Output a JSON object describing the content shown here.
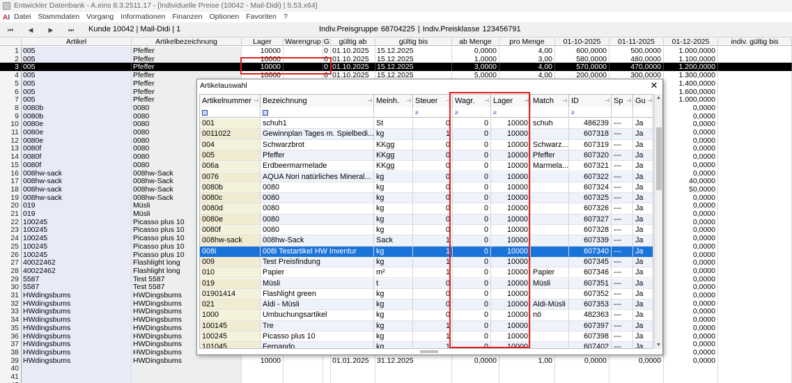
{
  "window": {
    "title": "Entwickler Datenbank - A.eins 8.3.2511.17 - [Individuelle Preise (10042 - Mail-Didi) | 5.53.x64]"
  },
  "menu": {
    "logo": "A",
    "logo2": "I",
    "items": [
      "Datei",
      "Stammdaten",
      "Vorgang",
      "Informationen",
      "Finanzen",
      "Optionen",
      "Favoriten",
      "?"
    ]
  },
  "nav": {
    "first": "⏮",
    "prev": "◀",
    "next": "▶",
    "last": "⏭",
    "kunde": "Kunde 10042 | Mail-Didi | 1",
    "preisgruppe": "Indiv.Preisgruppe 68704225 | Indiv.Preisklasse 123456791"
  },
  "grid": {
    "headers": [
      "Artikel",
      "Artikelbezeichnung",
      "Lager",
      "Warengrup",
      "G",
      "gültig ab",
      "gültig bis",
      "ab Menge",
      "pro Menge",
      "01-10-2025",
      "01-11-2025",
      "01-12-2025",
      "indiv. gültig bis"
    ],
    "rows": [
      [
        "1",
        "005",
        "Pfeffer",
        "10000",
        "0",
        "01.10.2025",
        "15.12.2025",
        "0,0000",
        "4,00",
        "600,0000",
        "500,0000",
        "1.000,0000",
        ""
      ],
      [
        "2",
        "005",
        "Pfeffer",
        "10000",
        "0",
        "01.10.2025",
        "15.12.2025",
        "1,0000",
        "3,00",
        "580,0000",
        "480,0000",
        "1.100,0000",
        ""
      ],
      [
        "3",
        "005",
        "Pfeffer",
        "10000",
        "0",
        "01.10.2025",
        "15.12.2025",
        "3,0000",
        "4,00",
        "570,0000",
        "470,0000",
        "1.200,0000",
        ""
      ],
      [
        "4",
        "005",
        "Pfeffer",
        "10000",
        "0",
        "01.10.2025",
        "15.12.2025",
        "5,0000",
        "4,00",
        "200,0000",
        "300,0000",
        "1.300,0000",
        ""
      ],
      [
        "5",
        "005",
        "Pfeffer",
        "",
        "",
        "",
        "",
        "",
        "",
        "",
        "",
        "1.400,0000",
        ""
      ],
      [
        "6",
        "005",
        "Pfeffer",
        "",
        "",
        "",
        "",
        "",
        "",
        "",
        "",
        "1.600,0000",
        ""
      ],
      [
        "7",
        "005",
        "Pfeffer",
        "",
        "",
        "",
        "",
        "",
        "",
        "",
        "",
        "1.000,0000",
        ""
      ],
      [
        "8",
        "0080b",
        "0080",
        "",
        "",
        "",
        "",
        "",
        "",
        "",
        "",
        "0,0000",
        ""
      ],
      [
        "9",
        "0080b",
        "0080",
        "",
        "",
        "",
        "",
        "",
        "",
        "",
        "",
        "0,0000",
        ""
      ],
      [
        "10",
        "0080e",
        "0080",
        "",
        "",
        "",
        "",
        "",
        "",
        "",
        "",
        "0,0000",
        ""
      ],
      [
        "11",
        "0080e",
        "0080",
        "",
        "",
        "",
        "",
        "",
        "",
        "",
        "",
        "0,0000",
        ""
      ],
      [
        "12",
        "0080e",
        "0080",
        "",
        "",
        "",
        "",
        "",
        "",
        "",
        "",
        "0,0000",
        ""
      ],
      [
        "13",
        "0080f",
        "0080",
        "",
        "",
        "",
        "",
        "",
        "",
        "",
        "",
        "0,0000",
        ""
      ],
      [
        "14",
        "0080f",
        "0080",
        "",
        "",
        "",
        "",
        "",
        "",
        "",
        "",
        "0,0000",
        ""
      ],
      [
        "15",
        "0080f",
        "0080",
        "",
        "",
        "",
        "",
        "",
        "",
        "",
        "",
        "0,0000",
        ""
      ],
      [
        "16",
        "008hw-sack",
        "008hw-Sack",
        "",
        "",
        "",
        "",
        "",
        "",
        "",
        "",
        "0,0000",
        ""
      ],
      [
        "17",
        "008hw-sack",
        "008hw-Sack",
        "",
        "",
        "",
        "",
        "",
        "",
        "",
        "",
        "40,0000",
        ""
      ],
      [
        "18",
        "008hw-sack",
        "008hw-Sack",
        "",
        "",
        "",
        "",
        "",
        "",
        "",
        "",
        "50,0000",
        ""
      ],
      [
        "19",
        "008hw-sack",
        "008hw-Sack",
        "",
        "",
        "",
        "",
        "",
        "",
        "",
        "",
        "0,0000",
        ""
      ],
      [
        "20",
        "019",
        "Müsli",
        "",
        "",
        "",
        "",
        "",
        "",
        "",
        "",
        "0,0000",
        ""
      ],
      [
        "21",
        "019",
        "Müsli",
        "",
        "",
        "",
        "",
        "",
        "",
        "",
        "",
        "0,0000",
        ""
      ],
      [
        "22",
        "100245",
        "Picasso plus 10",
        "",
        "",
        "",
        "",
        "",
        "",
        "",
        "",
        "0,0000",
        ""
      ],
      [
        "23",
        "100245",
        "Picasso plus 10",
        "",
        "",
        "",
        "",
        "",
        "",
        "",
        "",
        "0,0000",
        ""
      ],
      [
        "24",
        "100245",
        "Picasso plus 10",
        "",
        "",
        "",
        "",
        "",
        "",
        "",
        "",
        "0,0000",
        ""
      ],
      [
        "25",
        "100245",
        "Picasso plus 10",
        "",
        "",
        "",
        "",
        "",
        "",
        "",
        "",
        "0,0000",
        ""
      ],
      [
        "26",
        "100245",
        "Picasso plus 10",
        "",
        "",
        "",
        "",
        "",
        "",
        "",
        "",
        "0,0000",
        ""
      ],
      [
        "27",
        "40022462",
        "Flashlight long",
        "",
        "",
        "",
        "",
        "",
        "",
        "",
        "",
        "0,0000",
        ""
      ],
      [
        "28",
        "40022462",
        "Flashlight long",
        "",
        "",
        "",
        "",
        "",
        "",
        "",
        "",
        "0,0000",
        ""
      ],
      [
        "29",
        "5587",
        "Test 5587",
        "",
        "",
        "",
        "",
        "",
        "",
        "",
        "",
        "0,0000",
        ""
      ],
      [
        "30",
        "5587",
        "Test 5587",
        "",
        "",
        "",
        "",
        "",
        "",
        "",
        "",
        "0,0000",
        ""
      ],
      [
        "31",
        "HWdingsbums",
        "HWDingsbums",
        "",
        "",
        "",
        "",
        "",
        "",
        "",
        "",
        "0,0000",
        ""
      ],
      [
        "32",
        "HWdingsbums",
        "HWDingsbums",
        "",
        "",
        "",
        "",
        "",
        "",
        "",
        "",
        "0,0000",
        ""
      ],
      [
        "33",
        "HWdingsbums",
        "HWDingsbums",
        "",
        "",
        "",
        "",
        "",
        "",
        "",
        "",
        "0,0000",
        ""
      ],
      [
        "34",
        "HWdingsbums",
        "HWDingsbums",
        "",
        "",
        "",
        "",
        "",
        "",
        "",
        "",
        "0,0000",
        ""
      ],
      [
        "35",
        "HWdingsbums",
        "HWDingsbums",
        "",
        "",
        "",
        "",
        "",
        "",
        "",
        "",
        "0,0000",
        ""
      ],
      [
        "36",
        "HWdingsbums",
        "HWDingsbums",
        "",
        "",
        "",
        "",
        "",
        "",
        "",
        "",
        "0,0000",
        ""
      ],
      [
        "37",
        "HWdingsbums",
        "HWDingsbums",
        "",
        "",
        "",
        "",
        "",
        "",
        "",
        "",
        "0,0000",
        ""
      ],
      [
        "38",
        "HWdingsbums",
        "HWDingsbums",
        "",
        "",
        "",
        "",
        "",
        "",
        "",
        "",
        "0,0000",
        ""
      ],
      [
        "39",
        "HWdingsbums",
        "HWDingsbums",
        "10000",
        "",
        "01.01.2025",
        "31.12.2025",
        "0,0000",
        "1,00",
        "0,0000",
        "0,0000",
        "0,0000",
        ""
      ],
      [
        "40",
        "",
        "",
        "",
        "",
        "",
        "",
        "",
        "",
        "",
        "",
        "",
        ""
      ],
      [
        "41",
        "",
        "",
        "",
        "",
        "",
        "",
        "",
        "",
        "",
        "",
        "",
        ""
      ],
      [
        "42",
        "",
        "",
        "",
        "",
        "",
        "",
        "",
        "",
        "",
        "",
        "",
        ""
      ]
    ],
    "selected_row": 2
  },
  "dialog": {
    "title": "Artikelauswahl",
    "close": "✕",
    "headers": [
      "Artikelnummer",
      "Bezeichnung",
      "Meinh.",
      "Steuer",
      "Wagr.",
      "Lager",
      "Match",
      "ID",
      "Sp",
      "Gu"
    ],
    "filters": [
      "■",
      "■",
      "",
      "≥",
      "≥",
      "≥",
      "",
      "≥",
      "",
      ""
    ],
    "rows": [
      [
        "001",
        "schuh1",
        "St",
        "0",
        "0",
        "10000",
        "schuh",
        "486239",
        "---",
        "Ja"
      ],
      [
        "0011022",
        "Gewinnplan Tages m. Spielbedi...",
        "kg",
        "1",
        "0",
        "10000",
        "",
        "607318",
        "---",
        "Ja"
      ],
      [
        "004",
        "Schwarzbrot",
        "KKgg",
        "0",
        "0",
        "10000",
        "Schwarz...",
        "607319",
        "---",
        "Ja"
      ],
      [
        "005",
        "Pfeffer",
        "KKgg",
        "0",
        "0",
        "10000",
        "Pfeffer",
        "607320",
        "---",
        "Ja"
      ],
      [
        "006a",
        "Erdbeermarmelade",
        "KKgg",
        "0",
        "0",
        "10000",
        "Marmela...",
        "607321",
        "---",
        "Ja"
      ],
      [
        "0076",
        "AQUA Nori natürliches Mineral...",
        "kg",
        "0",
        "0",
        "10000",
        "",
        "607322",
        "---",
        "Ja"
      ],
      [
        "0080b",
        "0080",
        "kg",
        "0",
        "0",
        "10000",
        "",
        "607324",
        "---",
        "Ja"
      ],
      [
        "0080c",
        "0080",
        "kg",
        "0",
        "0",
        "10000",
        "",
        "607325",
        "---",
        "Ja"
      ],
      [
        "0080d",
        "0080",
        "kg",
        "0",
        "0",
        "10000",
        "",
        "607326",
        "---",
        "Ja"
      ],
      [
        "0080e",
        "0080",
        "kg",
        "0",
        "0",
        "10000",
        "",
        "607327",
        "---",
        "Ja"
      ],
      [
        "0080f",
        "0080",
        "kg",
        "0",
        "0",
        "10000",
        "",
        "607328",
        "---",
        "Ja"
      ],
      [
        "008hw-sack",
        "008hw-Sack",
        "Sack",
        "1",
        "0",
        "10000",
        "",
        "607339",
        "---",
        "Ja"
      ],
      [
        "008i",
        "008i Testartikel HW Inventur",
        "kg",
        "1",
        "0",
        "10000",
        "",
        "607340",
        "---",
        "Ja"
      ],
      [
        "009",
        "Test Preisfindung",
        "kg",
        "1",
        "0",
        "10000",
        "",
        "607345",
        "---",
        "Ja"
      ],
      [
        "010",
        "Papier",
        "m²",
        "1",
        "0",
        "10000",
        "Papier",
        "607346",
        "---",
        "Ja"
      ],
      [
        "019",
        "Müsli",
        "t",
        "0",
        "0",
        "10000",
        "Müsli",
        "607351",
        "---",
        "Ja"
      ],
      [
        "01901414",
        "Flashlight green",
        "kg",
        "0",
        "0",
        "10000",
        "",
        "607352",
        "---",
        "Ja"
      ],
      [
        "021",
        "Aldi - Müsli",
        "kg",
        "0",
        "0",
        "10000",
        "Aldi-Müsli",
        "607353",
        "---",
        "Ja"
      ],
      [
        "1000",
        "Umbuchungsartikel",
        "kg",
        "0",
        "0",
        "10000",
        "nö",
        "482363",
        "---",
        "Ja"
      ],
      [
        "100145",
        "Tre",
        "kg",
        "1",
        "0",
        "10000",
        "",
        "607397",
        "---",
        "Ja"
      ],
      [
        "100245",
        "Picasso plus 10",
        "kg",
        "1",
        "0",
        "10000",
        "",
        "607398",
        "---",
        "Ja"
      ],
      [
        "101045",
        "Fernando",
        "kg",
        "1",
        "0",
        "10000",
        "",
        "607402",
        "---",
        "Ja"
      ]
    ],
    "selected_row": 12
  },
  "scroll": {
    "up": "▲",
    "down": "▼"
  },
  "colors": {
    "highlight_box": "#e02020",
    "dialog_selection": "#1a73d9",
    "grid_selection": "#000000"
  }
}
